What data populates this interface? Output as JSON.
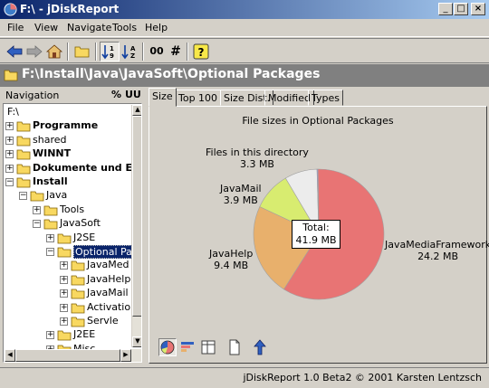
{
  "window": {
    "title": "F:\\ - jDiskReport",
    "controls": {
      "minimize": "_",
      "maximize": "□",
      "close": "×"
    }
  },
  "menu": [
    "File",
    "View",
    "Navigate",
    "Tools",
    "Help"
  ],
  "toolbar": {
    "buttons": [
      "back-icon",
      "forward-icon",
      "home-icon",
      "open-folder-icon",
      "sort-ascending-icon",
      "sort-descending-icon",
      "size-format-icon",
      "count-icon",
      "help-icon"
    ],
    "size_format_label": "00",
    "count_label": "#",
    "help_label": "?",
    "sort_asc_label": "1↓9",
    "sort_desc_label": "A↓Z"
  },
  "path": "F:\\Install\\Java\\JavaSoft\\Optional Packages",
  "navigation": {
    "header": "Navigation",
    "percent_label": "%",
    "uu_label": "UU",
    "tree": [
      {
        "label": "F:\\",
        "indent": 0,
        "expander": "",
        "folder": false,
        "bold": false
      },
      {
        "label": "Programme",
        "indent": 1,
        "expander": "+",
        "folder": true,
        "bold": true
      },
      {
        "label": "shared",
        "indent": 1,
        "expander": "+",
        "folder": true,
        "bold": false
      },
      {
        "label": "WINNT",
        "indent": 1,
        "expander": "+",
        "folder": true,
        "bold": true
      },
      {
        "label": "Dokumente und Ein",
        "indent": 1,
        "expander": "+",
        "folder": true,
        "bold": true
      },
      {
        "label": "Install",
        "indent": 1,
        "expander": "−",
        "folder": true,
        "bold": true
      },
      {
        "label": "Java",
        "indent": 2,
        "expander": "−",
        "folder": true,
        "bold": false
      },
      {
        "label": "Tools",
        "indent": 3,
        "expander": "+",
        "folder": true,
        "bold": false
      },
      {
        "label": "JavaSoft",
        "indent": 3,
        "expander": "−",
        "folder": true,
        "bold": false
      },
      {
        "label": "J2SE",
        "indent": 4,
        "expander": "+",
        "folder": true,
        "bold": false
      },
      {
        "label": "Optional Pa",
        "indent": 4,
        "expander": "−",
        "folder": true,
        "bold": false,
        "selected": true
      },
      {
        "label": "JavaMed",
        "indent": 5,
        "expander": "+",
        "folder": true,
        "bold": false
      },
      {
        "label": "JavaHelp",
        "indent": 5,
        "expander": "+",
        "folder": true,
        "bold": false
      },
      {
        "label": "JavaMail",
        "indent": 5,
        "expander": "+",
        "folder": true,
        "bold": false
      },
      {
        "label": "Activatio",
        "indent": 5,
        "expander": "+",
        "folder": true,
        "bold": false
      },
      {
        "label": "Servle",
        "indent": 5,
        "expander": "+",
        "folder": true,
        "bold": false
      },
      {
        "label": "J2EE",
        "indent": 4,
        "expander": "+",
        "folder": true,
        "bold": false
      },
      {
        "label": "Misc",
        "indent": 4,
        "expander": "+",
        "folder": true,
        "bold": false
      }
    ]
  },
  "tabs": [
    {
      "label": "Size",
      "active": true
    },
    {
      "label": "Top 100",
      "active": false
    },
    {
      "label": "Size Dist.",
      "active": false
    },
    {
      "label": "Modified",
      "active": false
    },
    {
      "label": "Types",
      "active": false
    }
  ],
  "chart_data": {
    "type": "pie",
    "title": "File sizes in Optional Packages",
    "unit": "MB",
    "slices": [
      {
        "name": "JavaMediaFramework",
        "value": 24.2,
        "value_label": "24.2 MB",
        "color": "#e87474"
      },
      {
        "name": "JavaHelp",
        "value": 9.4,
        "value_label": "9.4 MB",
        "color": "#e8b06c"
      },
      {
        "name": "JavaMail",
        "value": 3.9,
        "value_label": "3.9 MB",
        "color": "#d8ec70"
      },
      {
        "name": "Files in this directory",
        "value": 3.3,
        "value_label": "3.3 MB",
        "color": "#ececec"
      },
      {
        "name": "",
        "value": 0.1,
        "value_label": "",
        "color": "#9c9cd8"
      }
    ],
    "total": {
      "label": "Total:",
      "value_label": "41.9 MB"
    }
  },
  "chart_toolbar": [
    "pie-chart-icon",
    "bar-chart-icon",
    "table-icon",
    "text-icon",
    "up-icon"
  ],
  "status": "jDiskReport 1.0 Beta2 © 2001 Karsten Lentzsch",
  "colors": {
    "title_gradient_start": "#0a246a",
    "path_background": "#808080",
    "folder_yellow": "#f8d860"
  }
}
